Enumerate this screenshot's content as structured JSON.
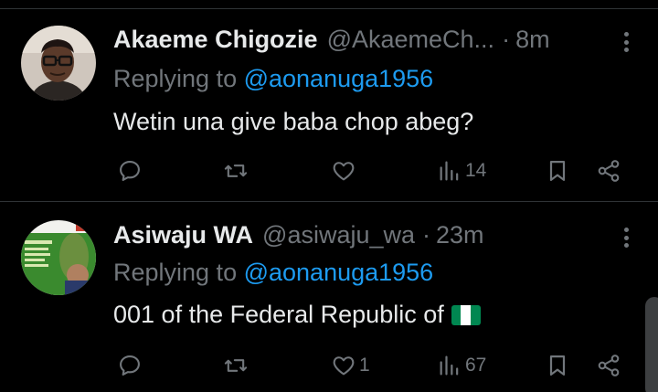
{
  "tweets": [
    {
      "name": "Akaeme Chigozie",
      "handle": "@AkaemeCh...",
      "time": "8m",
      "replying_prefix": "Replying to ",
      "replying_to": "@aonanuga1956",
      "text": "Wetin una give baba chop abeg?",
      "likes": "",
      "views": "14",
      "avatar_icon": "man-with-glasses-avatar"
    },
    {
      "name": "Asiwaju WA",
      "handle": "@asiwaju_wa",
      "time": "23m",
      "replying_prefix": "Replying to ",
      "replying_to": "@aonanuga1956",
      "text": "001 of the Federal Republic of",
      "likes": "1",
      "views": "67",
      "avatar_icon": "poster-avatar",
      "emoji": "nigeria-flag"
    }
  ],
  "colors": {
    "background": "#000000",
    "primary_text": "#e7e9ea",
    "secondary_text": "#71767b",
    "mention": "#1d9bf0",
    "divider": "#2f3336",
    "flag_green": "#008751",
    "flag_white": "#ffffff"
  },
  "separator_dot": "·"
}
